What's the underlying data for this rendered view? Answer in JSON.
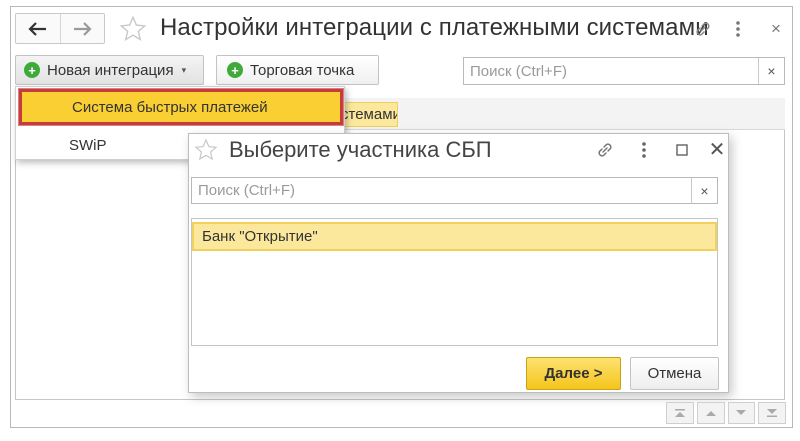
{
  "window": {
    "title": "Настройки интеграции с платежными системами"
  },
  "toolbar": {
    "new_integration_label": "Новая интеграция",
    "trade_point_label": "Торговая точка",
    "search_placeholder": "Поиск (Ctrl+F)",
    "search_clear": "×"
  },
  "table": {
    "highlighted_cell_text": "стемами"
  },
  "menu": {
    "items": [
      {
        "label": "Система быстрых платежей",
        "selected": true
      },
      {
        "label": "SWiP",
        "selected": false
      }
    ]
  },
  "dialog": {
    "title": "Выберите участника СБП",
    "search_placeholder": "Поиск (Ctrl+F)",
    "search_clear": "×",
    "list": [
      {
        "label": "Банк \"Открытие\"",
        "selected": true
      }
    ],
    "next_label": "Далее >",
    "cancel_label": "Отмена",
    "close_glyph": "✕"
  },
  "colors": {
    "accent_yellow": "#f9cf33",
    "selection_row": "#fbe89c",
    "highlight_border_red": "#c63b3b",
    "plus_green": "#3faa3a"
  },
  "icons": [
    "back-arrow-icon",
    "forward-arrow-icon",
    "star-icon",
    "link-icon",
    "more-vertical-icon",
    "close-icon",
    "plus-circle-icon",
    "dropdown-caret-icon",
    "maximize-icon",
    "first-page-icon",
    "prev-page-icon",
    "next-page-icon",
    "last-page-icon"
  ]
}
